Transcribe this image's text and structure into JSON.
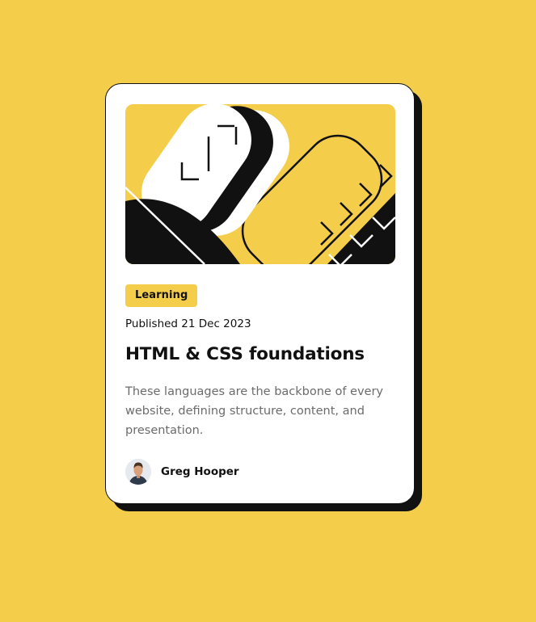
{
  "page": {
    "background_color": "#F4CE4B"
  },
  "card": {
    "image_icon": "abstract-illustration-icon",
    "tag": "Learning",
    "published": "Published 21 Dec 2023",
    "title": "HTML & CSS foundations",
    "description": "These languages are the backbone of every website, defining structure, content, and presentation.",
    "author": {
      "name": "Greg Hooper",
      "avatar_icon": "avatar-icon"
    }
  },
  "colors": {
    "accent": "#F4CE4B",
    "text": "#111111",
    "muted": "#6B6B6B",
    "card": "#FFFFFF"
  }
}
